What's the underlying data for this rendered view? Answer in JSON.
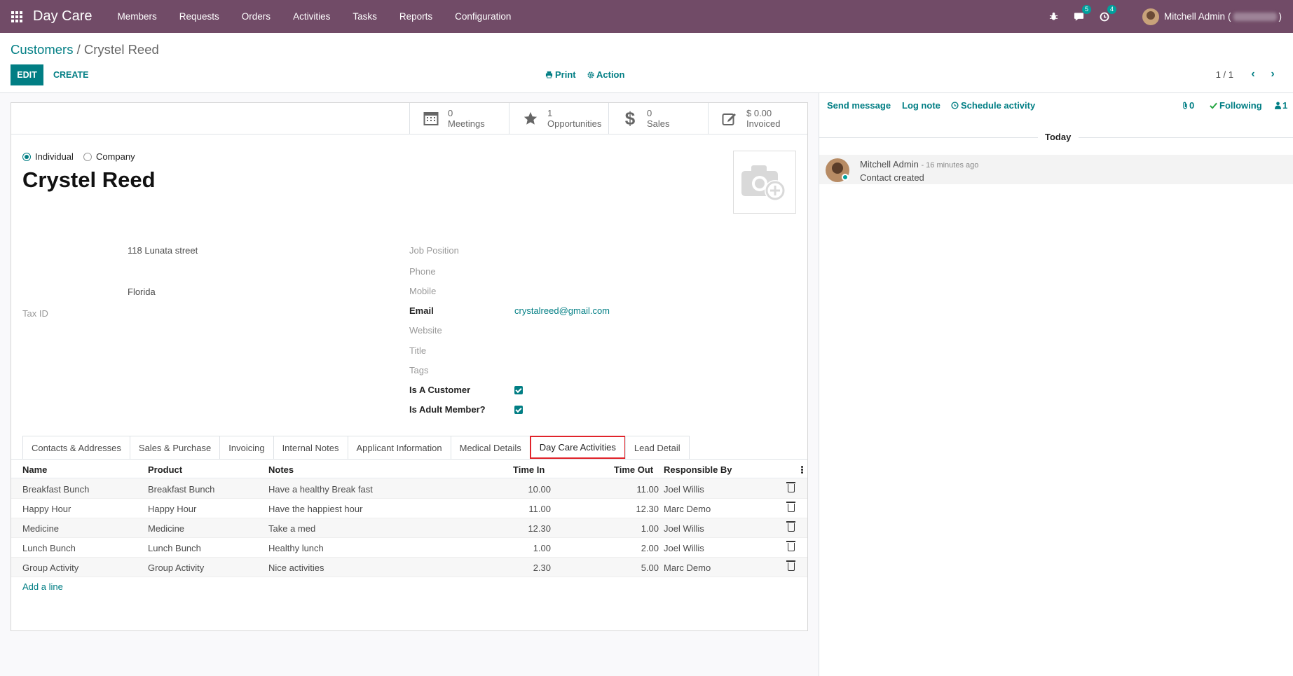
{
  "navbar": {
    "brand": "Day Care",
    "menu": [
      "Members",
      "Requests",
      "Orders",
      "Activities",
      "Tasks",
      "Reports",
      "Configuration"
    ],
    "chat_count": "5",
    "activity_count": "4",
    "user_name": "Mitchell Admin",
    "user_db_open": "(",
    "user_db_close": ")"
  },
  "breadcrumb": {
    "parent": "Customers",
    "separator": " / ",
    "current": "Crystel Reed"
  },
  "control": {
    "edit": "EDIT",
    "create": "CREATE",
    "print": "Print",
    "action": "Action",
    "pager": "1 / 1"
  },
  "stat_buttons": [
    {
      "value": "0",
      "label": "Meetings",
      "icon": "calendar-icon"
    },
    {
      "value": "1",
      "label": "Opportunities",
      "icon": "star-icon"
    },
    {
      "value": "0",
      "label": "Sales",
      "icon": "dollar-icon"
    },
    {
      "value": "$ 0.00",
      "label": "Invoiced",
      "icon": "edit-icon"
    }
  ],
  "partner": {
    "type_individual": "Individual",
    "type_company": "Company",
    "name": "Crystel Reed",
    "street": "118 Lunata street",
    "state": "Florida",
    "tax_id_label": "Tax ID"
  },
  "fields": {
    "job_position": "Job Position",
    "phone": "Phone",
    "mobile": "Mobile",
    "email_label": "Email",
    "email": "crystalreed@gmail.com",
    "website": "Website",
    "title": "Title",
    "tags": "Tags",
    "is_customer": "Is A Customer",
    "is_adult": "Is Adult Member?"
  },
  "tabs": [
    "Contacts & Addresses",
    "Sales & Purchase",
    "Invoicing",
    "Internal Notes",
    "Applicant Information",
    "Medical Details",
    "Day Care Activities",
    "Lead Detail"
  ],
  "table": {
    "headers": {
      "name": "Name",
      "product": "Product",
      "notes": "Notes",
      "time_in": "Time In",
      "time_out": "Time Out",
      "responsible": "Responsible By"
    },
    "rows": [
      {
        "name": "Breakfast Bunch",
        "product": "Breakfast Bunch",
        "notes": "Have a healthy Break fast",
        "time_in": "10.00",
        "time_out": "11.00",
        "responsible": "Joel Willis"
      },
      {
        "name": "Happy Hour",
        "product": "Happy Hour",
        "notes": "Have the happiest hour",
        "time_in": "11.00",
        "time_out": "12.30",
        "responsible": "Marc Demo"
      },
      {
        "name": "Medicine",
        "product": "Medicine",
        "notes": "Take a med",
        "time_in": "12.30",
        "time_out": "1.00",
        "responsible": "Joel Willis"
      },
      {
        "name": "Lunch Bunch",
        "product": "Lunch Bunch",
        "notes": "Healthy lunch",
        "time_in": "1.00",
        "time_out": "2.00",
        "responsible": "Joel Willis"
      },
      {
        "name": "Group Activity",
        "product": "Group Activity",
        "notes": "Nice activities",
        "time_in": "2.30",
        "time_out": "5.00",
        "responsible": "Marc Demo"
      }
    ],
    "add_line": "Add a line"
  },
  "chatter": {
    "send_message": "Send message",
    "log_note": "Log note",
    "schedule_activity": "Schedule activity",
    "attachments": "0",
    "following": "Following",
    "followers": "1",
    "today": "Today",
    "author": "Mitchell Admin",
    "time": "- 16 minutes ago",
    "body": "Contact created"
  },
  "colors": {
    "navbar": "#714b67",
    "accent": "#017e84",
    "active_tab_border": "#e0242b"
  }
}
